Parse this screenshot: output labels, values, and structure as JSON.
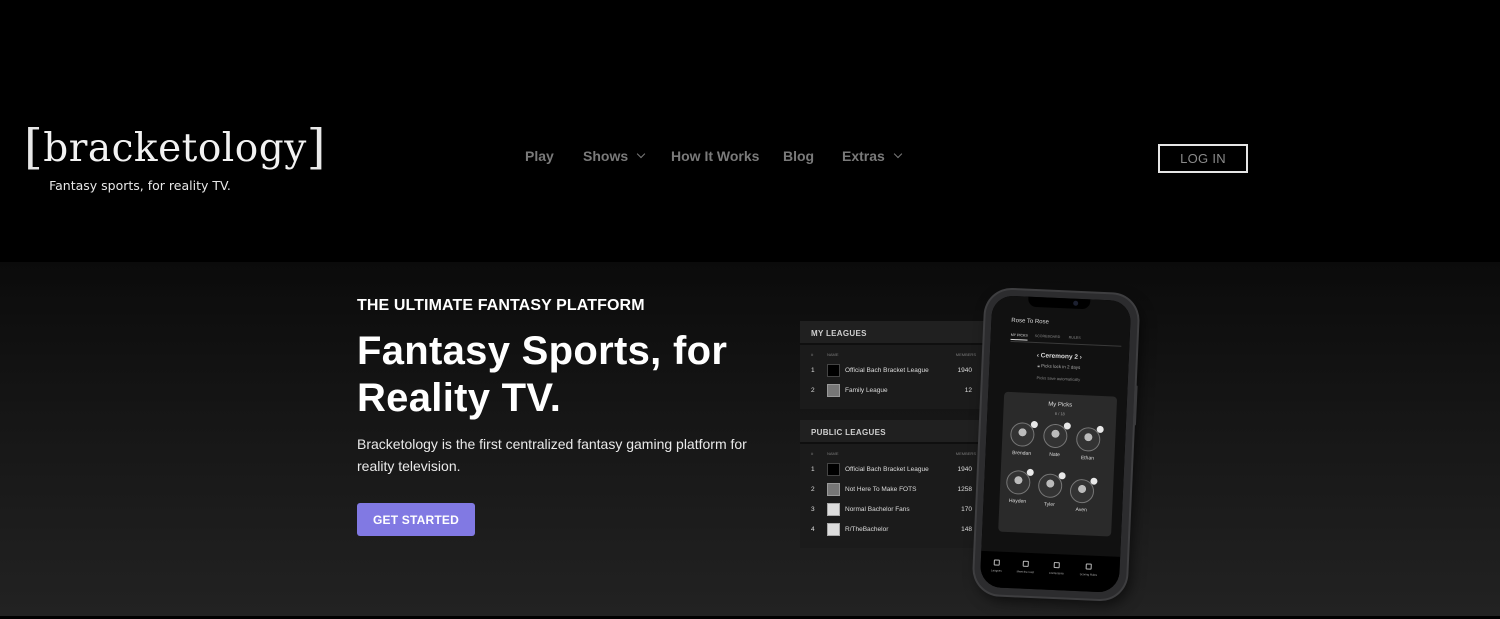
{
  "header": {
    "logo": {
      "bracket_open": "[",
      "word": "bracketology",
      "bracket_close": "]",
      "tagline": "Fantasy sports, for reality TV."
    },
    "nav": [
      {
        "label": "Play",
        "has_dropdown": false
      },
      {
        "label": "Shows",
        "has_dropdown": true
      },
      {
        "label": "How It Works",
        "has_dropdown": false
      },
      {
        "label": "Blog",
        "has_dropdown": false
      },
      {
        "label": "Extras",
        "has_dropdown": true
      }
    ],
    "login_label": "LOG IN"
  },
  "hero": {
    "eyebrow": "THE ULTIMATE FANTASY PLATFORM",
    "headline": "Fantasy Sports, for Reality TV.",
    "description": "Bracketology is the first centralized fantasy gaming platform for reality television.",
    "cta_label": "GET STARTED",
    "cta_color": "#8179e3"
  },
  "my_leagues": {
    "title": "MY LEAGUES",
    "columns": {
      "rank": "#",
      "name": "NAME",
      "members": "MEMBERS"
    },
    "rows": [
      {
        "rank": "1",
        "name": "Official Bach Bracket League",
        "members": "1940",
        "icon": "bracket-logo-icon"
      },
      {
        "rank": "2",
        "name": "Family League",
        "members": "12",
        "icon": "image-thumb-icon"
      }
    ]
  },
  "public_leagues": {
    "title": "PUBLIC LEAGUES",
    "columns": {
      "rank": "#",
      "name": "NAME",
      "members": "MEMBERS"
    },
    "rows": [
      {
        "rank": "1",
        "name": "Official Bach Bracket League",
        "members": "1940",
        "icon": "bracket-logo-icon"
      },
      {
        "rank": "2",
        "name": "Not Here To Make FOTS",
        "members": "1258",
        "icon": "image-thumb-icon"
      },
      {
        "rank": "3",
        "name": "Normal Bachelor Fans",
        "members": "170",
        "icon": "image-thumb-icon"
      },
      {
        "rank": "4",
        "name": "R/TheBachelor",
        "members": "148",
        "icon": "image-thumb-icon"
      }
    ]
  },
  "phone": {
    "app_title": "Rose To Rose",
    "tabs": [
      "MY PICKS",
      "SCOREBOARD",
      "RULES"
    ],
    "ceremony": "Ceremony 2",
    "lock_text": "Picks lock in 2 days",
    "autosave_text": "Picks save automatically",
    "picks_title": "My Picks",
    "picks_count": "6 / 18",
    "picks": [
      "Brendan",
      "Nate",
      "Ethan",
      "Hayden",
      "Tyler",
      "Aven"
    ],
    "bottom_nav": [
      "Leagues",
      "Meet the Cast",
      "Contestants",
      "Scoring Rules"
    ]
  }
}
